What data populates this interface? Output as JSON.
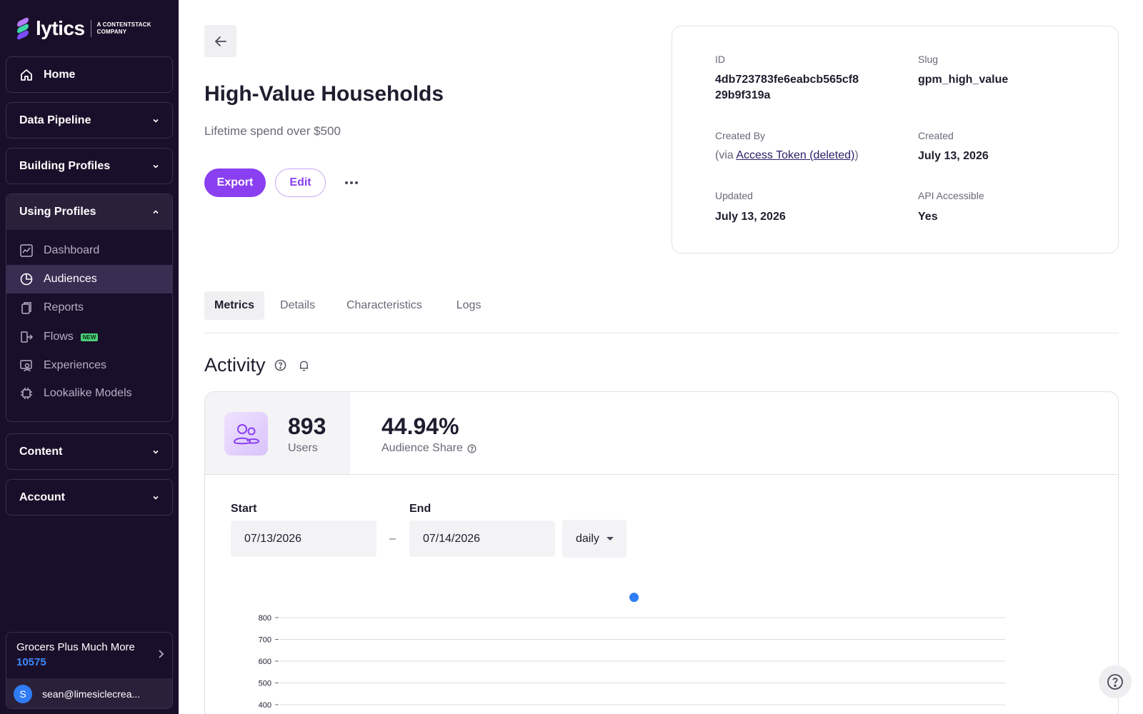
{
  "brand": {
    "name": "lytics",
    "tagline_line1": "A CONTENTSTACK",
    "tagline_line2": "COMPANY"
  },
  "sidebar": {
    "home": "Home",
    "sections": [
      {
        "label": "Data Pipeline"
      },
      {
        "label": "Building Profiles"
      },
      {
        "label": "Using Profiles"
      },
      {
        "label": "Content"
      },
      {
        "label": "Account"
      }
    ],
    "using_profiles_items": [
      {
        "label": "Dashboard",
        "icon": "chart-icon"
      },
      {
        "label": "Audiences",
        "icon": "pie-icon",
        "active": true
      },
      {
        "label": "Reports",
        "icon": "copy-icon"
      },
      {
        "label": "Flows",
        "icon": "flow-icon",
        "badge": "NEW"
      },
      {
        "label": "Experiences",
        "icon": "experience-icon"
      },
      {
        "label": "Lookalike Models",
        "icon": "chip-icon"
      }
    ],
    "account": {
      "name": "Grocers Plus Much More",
      "id": "10575",
      "user_initial": "S",
      "user_email": "sean@limesiclecrea..."
    }
  },
  "audience": {
    "title": "High-Value Households",
    "description": "Lifetime spend over $500",
    "export_label": "Export",
    "edit_label": "Edit"
  },
  "info": {
    "id_label": "ID",
    "id_line1": "4db723783fe6eabcb565cf8",
    "id_line2": "29b9f319a",
    "slug_label": "Slug",
    "slug_value": "gpm_high_value",
    "created_by_label": "Created By",
    "created_by_prefix": "(via ",
    "created_by_link": "Access Token (deleted)",
    "created_by_suffix": ")",
    "created_label": "Created",
    "created_value": "July 13, 2026",
    "updated_label": "Updated",
    "updated_value": "July 13, 2026",
    "api_label": "API Accessible",
    "api_value": "Yes"
  },
  "tabs": [
    "Metrics",
    "Details",
    "Characteristics",
    "Logs"
  ],
  "activity": {
    "title": "Activity",
    "users_value": "893",
    "users_label": "Users",
    "share_value": "44.94%",
    "share_label": "Audience Share",
    "start_label": "Start",
    "start_value": "07/13/2026",
    "end_label": "End",
    "end_value": "07/14/2026",
    "range_dash": "–",
    "interval": "daily"
  },
  "colors": {
    "accent": "#8a3ff0",
    "sidebar_bg": "#1a0f2a",
    "point": "#2f7cf6",
    "link_blue": "#3d8bff"
  },
  "chart_data": {
    "type": "scatter",
    "y_ticks": [
      800,
      700,
      600,
      500,
      400
    ],
    "ylim": [
      400,
      800
    ],
    "series": [
      {
        "points": [
          {
            "x": "07/13/2026",
            "y": 893
          }
        ]
      }
    ],
    "grid": true
  }
}
